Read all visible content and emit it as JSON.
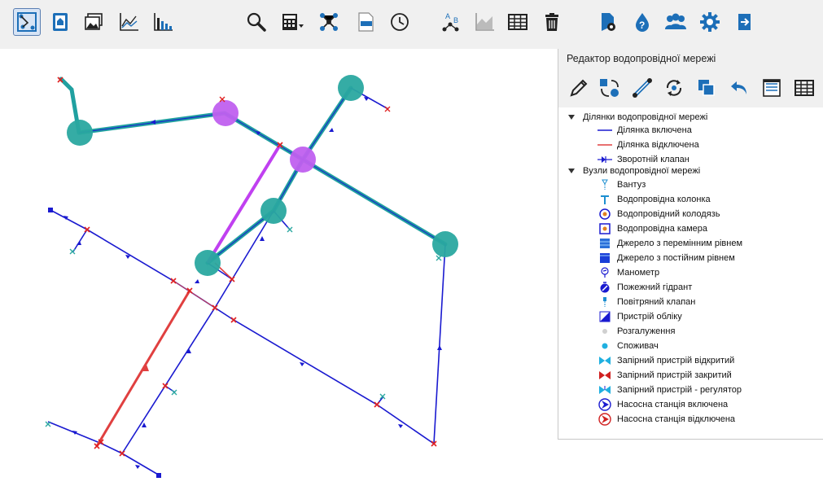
{
  "toolbar": {
    "buttons": [
      {
        "name": "network-edit-icon",
        "active": true
      },
      {
        "name": "catalog-icon"
      },
      {
        "name": "image-icon"
      },
      {
        "name": "profile-chart-icon"
      },
      {
        "name": "bar-chart-icon"
      },
      {
        "name": "search-icon"
      },
      {
        "name": "calculator-icon"
      },
      {
        "name": "network-graph-icon"
      },
      {
        "name": "dxf-file-icon"
      },
      {
        "name": "time-icon"
      },
      {
        "name": "node-labels-icon"
      },
      {
        "name": "area-chart-icon"
      },
      {
        "name": "table-icon"
      },
      {
        "name": "trash-icon"
      },
      {
        "name": "settings-doc-icon"
      },
      {
        "name": "water-help-icon"
      },
      {
        "name": "users-icon"
      },
      {
        "name": "gear-icon"
      },
      {
        "name": "exit-icon"
      }
    ]
  },
  "panel": {
    "title": "Редактор водопровідної мережі",
    "groups": [
      {
        "label": "Ділянки водопровідної мережі"
      },
      {
        "label": "Вузли водопровідної мережі"
      }
    ],
    "pipes": [
      {
        "label": "Ділянка включена",
        "icon": "pipe-enabled-icon"
      },
      {
        "label": "Ділянка відключена",
        "icon": "pipe-disabled-icon"
      },
      {
        "label": "Зворотній клапан",
        "icon": "check-valve-icon"
      }
    ],
    "nodes": [
      {
        "label": "Вантуз",
        "icon": "air-valve-icon"
      },
      {
        "label": "Водопровідна колонка",
        "icon": "water-column-icon"
      },
      {
        "label": "Водопровідний колодязь",
        "icon": "water-well-icon"
      },
      {
        "label": "Водопровідна камера",
        "icon": "water-chamber-icon"
      },
      {
        "label": "Джерело з перемінним рівнем",
        "icon": "variable-source-icon"
      },
      {
        "label": "Джерело з постійним рівнем",
        "icon": "constant-source-icon"
      },
      {
        "label": "Манометр",
        "icon": "manometer-icon"
      },
      {
        "label": "Пожежний гідрант",
        "icon": "fire-hydrant-icon"
      },
      {
        "label": "Повітряний клапан",
        "icon": "air-release-valve-icon"
      },
      {
        "label": "Пристрій обліку",
        "icon": "meter-icon"
      },
      {
        "label": "Розгалуження",
        "icon": "junction-icon"
      },
      {
        "label": "Споживач",
        "icon": "consumer-icon"
      },
      {
        "label": "Запірний пристрій відкритий",
        "icon": "valve-open-icon"
      },
      {
        "label": "Запірний пристрій закритий",
        "icon": "valve-closed-icon"
      },
      {
        "label": "Запірний пристрій - регулятор",
        "icon": "valve-regulator-icon"
      },
      {
        "label": "Насосна станція включена",
        "icon": "pump-on-icon"
      },
      {
        "label": "Насосна станція відключена",
        "icon": "pump-off-icon"
      }
    ]
  },
  "colors": {
    "pipe": "#1a1ad0",
    "pipe_disabled": "#e04040",
    "highlight": "#c040f0",
    "teal": "#20a0a0",
    "node_teal": "#2aa8a0",
    "node_purple": "#c060f0"
  }
}
